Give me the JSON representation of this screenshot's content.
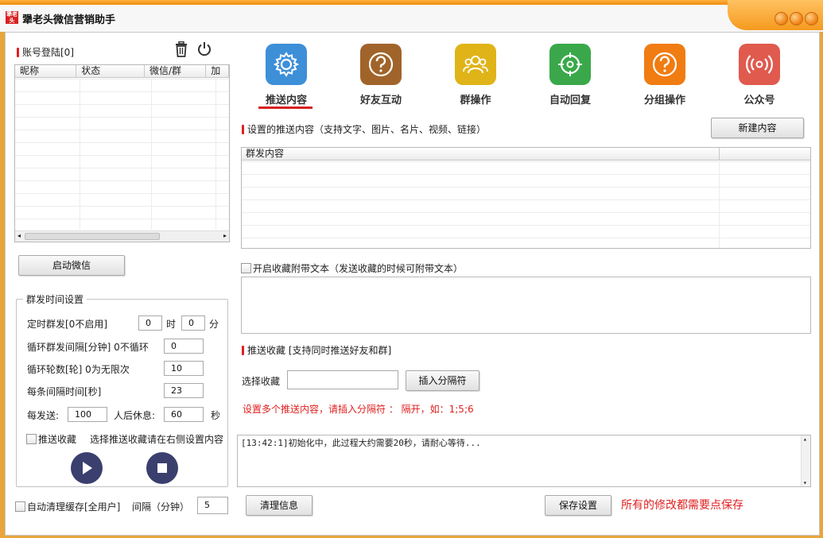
{
  "app": {
    "title": "犟老头微信营销助手",
    "logo_text": "犟老头"
  },
  "colors": {
    "accent_red": "#d82020",
    "nav_settings": "#3d8fd8",
    "nav_friends": "#a0642a",
    "nav_group": "#e0b418",
    "nav_auto": "#3aa84a",
    "nav_group_ops": "#f07c12",
    "nav_official": "#e05a4e",
    "play_button": "#3a3f6e"
  },
  "accounts": {
    "section_title": "账号登陆[0]",
    "delete_icon": "trash-icon",
    "power_icon": "power-icon",
    "columns": [
      "昵称",
      "状态",
      "微信/群",
      "加"
    ],
    "start_button": "启动微信"
  },
  "schedule": {
    "group_title": "群发时间设置",
    "timed_label": "定时群发[0不启用]",
    "timed_hour": "0",
    "hour_unit": "时",
    "timed_minute": "0",
    "minute_unit": "分",
    "interval_label": "循环群发间隔[分钟] 0不循环",
    "interval_value": "0",
    "rounds_label": "循环轮数[轮] 0为无限次",
    "rounds_value": "10",
    "each_label": "每条间隔时间[秒]",
    "each_value": "23",
    "per_send_label": "每发送:",
    "per_send_value": "100",
    "rest_label": "人后休息:",
    "rest_value": "60",
    "rest_unit": "秒",
    "push_fav_label": "推送收藏",
    "push_fav_hint": "选择推送收藏请在右侧设置内容"
  },
  "bottom_left": {
    "auto_clean_label": "自动清理缓存[全用户]",
    "interval_label": "间隔（分钟）",
    "interval_value": "5",
    "clear_button": "清理信息"
  },
  "nav": [
    {
      "label": "推送内容",
      "icon": "gear-icon"
    },
    {
      "label": "好友互动",
      "icon": "question-icon"
    },
    {
      "label": "群操作",
      "icon": "group-icon"
    },
    {
      "label": "自动回复",
      "icon": "target-icon"
    },
    {
      "label": "分组操作",
      "icon": "question-icon"
    },
    {
      "label": "公众号",
      "icon": "broadcast-icon"
    }
  ],
  "push": {
    "section_title": "设置的推送内容（支持文字、图片、名片、视频、链接）",
    "new_button": "新建内容",
    "table_column": "群发内容",
    "attach_checkbox": "开启收藏附带文本（发送收藏的时候可附带文本）",
    "fav_title": "推送收藏 [支持同时推送好友和群]",
    "select_fav_label": "选择收藏",
    "select_fav_value": "",
    "insert_sep_button": "插入分隔符",
    "hint": "设置多个推送内容，请插入分隔符 ： 隔开，如：1;5;6"
  },
  "log": {
    "line": "[13:42:1]初始化中，此过程大约需要20秒，请耐心等待..."
  },
  "footer": {
    "save_button": "保存设置",
    "save_hint": "所有的修改都需要点保存"
  }
}
